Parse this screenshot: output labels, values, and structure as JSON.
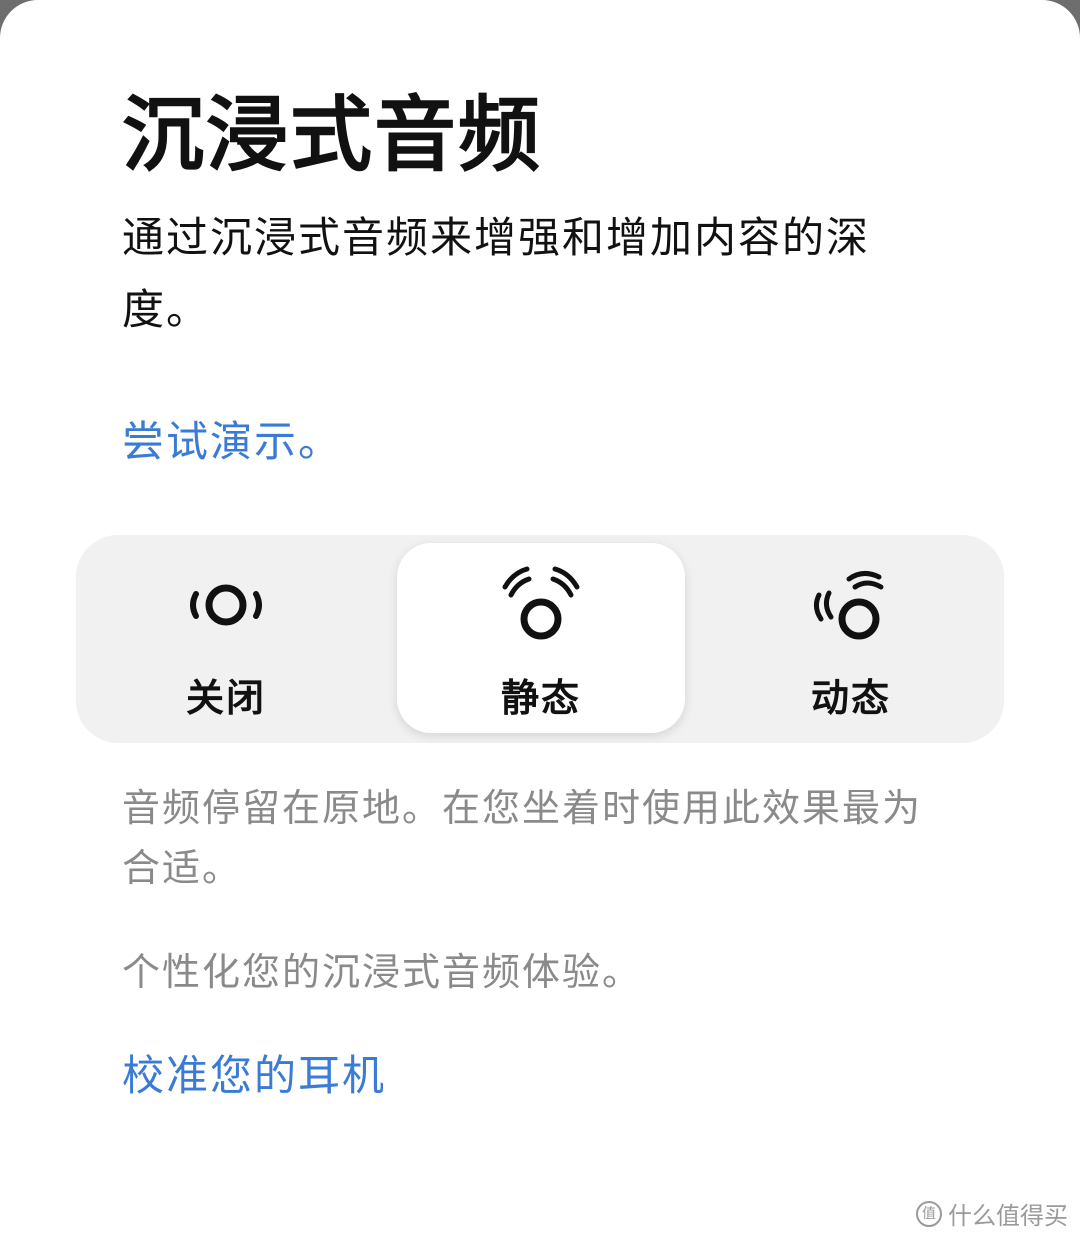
{
  "page": {
    "title": "沉浸式音频",
    "description": "通过沉浸式音频来增强和增加内容的深度。",
    "demo_link": "尝试演示。"
  },
  "modes": {
    "selected": "static",
    "items": [
      {
        "id": "off",
        "label": "关闭",
        "icon": "audio-off-icon"
      },
      {
        "id": "static",
        "label": "静态",
        "icon": "audio-static-icon"
      },
      {
        "id": "dynamic",
        "label": "动态",
        "icon": "audio-dynamic-icon"
      }
    ],
    "description": "音频停留在原地。在您坐着时使用此效果最为合适。"
  },
  "personalize": {
    "text": "个性化您的沉浸式音频体验。",
    "calibrate_link": "校准您的耳机"
  },
  "watermark": {
    "icon": "值",
    "text": "什么值得买"
  },
  "colors": {
    "link": "#3a7bd5",
    "selected_segment": "#ffffff",
    "segment_track": "#f1f1f1",
    "secondary_text": "#8a8a8a"
  }
}
